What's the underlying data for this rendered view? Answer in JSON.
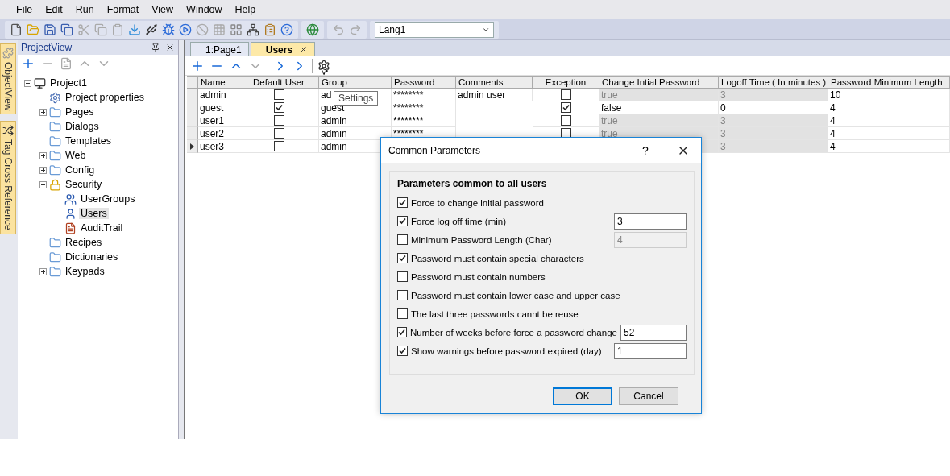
{
  "menu": [
    "File",
    "Edit",
    "Run",
    "Format",
    "View",
    "Window",
    "Help"
  ],
  "language_select": {
    "value": "Lang1"
  },
  "side_tabs": [
    "ObjectView",
    "Tag Cross Reference"
  ],
  "project_view": {
    "title": "ProjectView",
    "tree": [
      {
        "label": "Project1",
        "kind": "project",
        "expanded": true,
        "selected": false,
        "children": [
          {
            "label": "Project properties",
            "kind": "properties",
            "selected": false
          },
          {
            "label": "Pages",
            "kind": "folder",
            "expanded": false,
            "selected": false
          },
          {
            "label": "Dialogs",
            "kind": "folder",
            "selected": false
          },
          {
            "label": "Templates",
            "kind": "folder",
            "selected": false
          },
          {
            "label": "Web",
            "kind": "folder",
            "expanded": false,
            "selected": false
          },
          {
            "label": "Config",
            "kind": "folder",
            "expanded": false,
            "selected": false
          },
          {
            "label": "Security",
            "kind": "lock",
            "expanded": true,
            "selected": false,
            "children": [
              {
                "label": "UserGroups",
                "kind": "usergroups",
                "selected": false
              },
              {
                "label": "Users",
                "kind": "user",
                "selected": true
              },
              {
                "label": "AuditTrail",
                "kind": "audit",
                "selected": false
              }
            ]
          },
          {
            "label": "Recipes",
            "kind": "folder",
            "selected": false
          },
          {
            "label": "Dictionaries",
            "kind": "folder",
            "selected": false
          },
          {
            "label": "Keypads",
            "kind": "folder",
            "expanded": false,
            "selected": false
          }
        ]
      }
    ]
  },
  "doc_tabs": [
    {
      "label": "1:Page1",
      "selected": false
    },
    {
      "label": "Users",
      "selected": true
    }
  ],
  "tooltip": "Settings",
  "grid": {
    "columns": [
      {
        "label": "Name",
        "kind": "text"
      },
      {
        "label": "Default User",
        "kind": "check"
      },
      {
        "label": "Group",
        "kind": "text"
      },
      {
        "label": "Password",
        "kind": "text"
      },
      {
        "label": "Comments",
        "kind": "text"
      },
      {
        "label": "Exception",
        "kind": "check"
      },
      {
        "label": "Change Intial Password",
        "kind": "derived"
      },
      {
        "label": "Logoff Time ( In minutes )",
        "kind": "derived"
      },
      {
        "label": "Password Minimum Length",
        "kind": "text"
      }
    ],
    "rows": [
      {
        "selected": false,
        "disabled": true,
        "cells": [
          "admin",
          false,
          "ad",
          "********",
          "admin user",
          false,
          "true",
          "3",
          "10"
        ]
      },
      {
        "selected": false,
        "disabled": false,
        "cells": [
          "guest",
          true,
          "guest",
          "********",
          null,
          true,
          "false",
          "0",
          "4"
        ]
      },
      {
        "selected": false,
        "disabled": true,
        "cells": [
          "user1",
          false,
          "admin",
          "********",
          null,
          false,
          "true",
          "3",
          "4"
        ]
      },
      {
        "selected": false,
        "disabled": true,
        "cells": [
          "user2",
          false,
          "admin",
          "********",
          null,
          false,
          "true",
          "3",
          "4"
        ]
      },
      {
        "selected": true,
        "disabled": true,
        "cells": [
          "user3",
          false,
          "admin",
          null,
          null,
          null,
          null,
          "3",
          "4"
        ]
      }
    ]
  },
  "dialog": {
    "title": "Common Parameters",
    "help_label": "?",
    "group_title": "Parameters common to all users",
    "options": [
      {
        "label": "Force to change initial password",
        "checked": true
      },
      {
        "label": "Force log off time (min)",
        "checked": true,
        "field": {
          "value": "3",
          "disabled": false
        }
      },
      {
        "label": "Minimum Password Length (Char)",
        "checked": false,
        "field": {
          "value": "4",
          "disabled": true
        }
      },
      {
        "label": "Password must contain special characters",
        "checked": true
      },
      {
        "label": "Password must contain numbers",
        "checked": false
      },
      {
        "label": "Password must contain lower case and upper case",
        "checked": false
      },
      {
        "label": "The last three passwords cannt be reuse",
        "checked": false
      },
      {
        "label": "Number of weeks before force a password change",
        "checked": true,
        "field": {
          "value": "52",
          "disabled": false
        }
      },
      {
        "label": "Show warnings before password expired (day)",
        "checked": true,
        "field": {
          "value": "1",
          "disabled": false
        }
      }
    ],
    "buttons": [
      {
        "label": "OK",
        "default": true
      },
      {
        "label": "Cancel",
        "default": false
      }
    ]
  }
}
